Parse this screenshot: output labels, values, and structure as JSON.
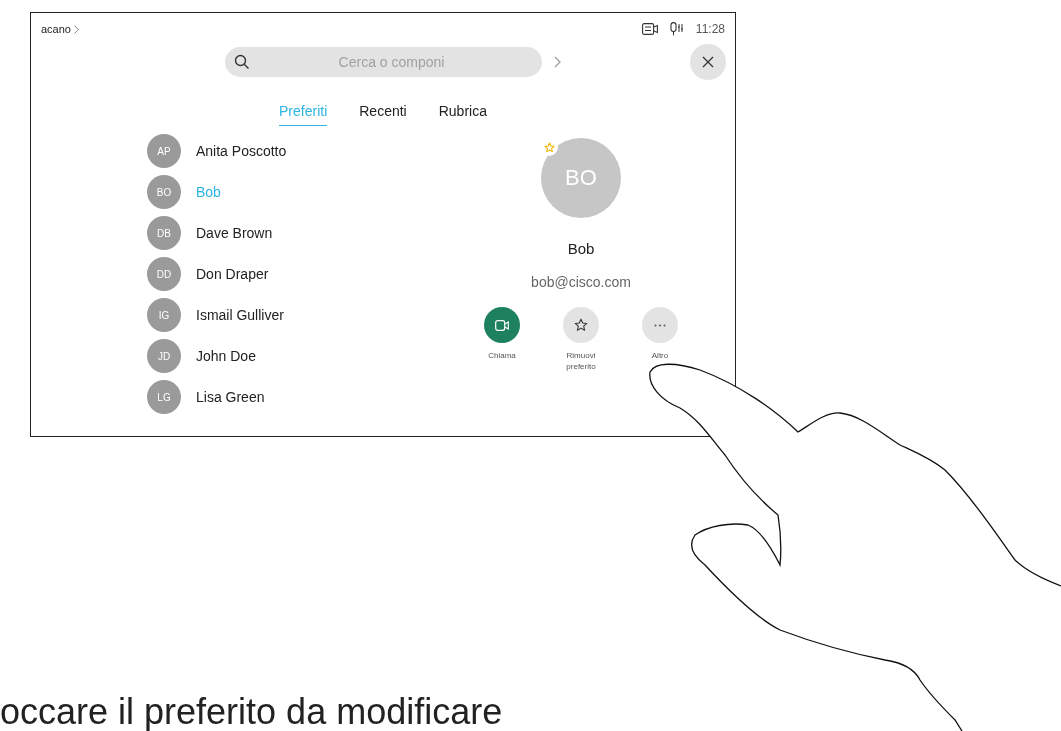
{
  "status_bar": {
    "system_name": "acano",
    "time": "11:28"
  },
  "search": {
    "placeholder": "Cerca o componi"
  },
  "tabs": [
    {
      "label": "Preferiti",
      "selected": true
    },
    {
      "label": "Recenti",
      "selected": false
    },
    {
      "label": "Rubrica",
      "selected": false
    }
  ],
  "contacts": [
    {
      "initials": "AP",
      "name": "Anita Poscotto",
      "selected": false
    },
    {
      "initials": "BO",
      "name": "Bob",
      "selected": true
    },
    {
      "initials": "DB",
      "name": "Dave Brown",
      "selected": false
    },
    {
      "initials": "DD",
      "name": "Don Draper",
      "selected": false
    },
    {
      "initials": "IG",
      "name": "Ismail Gulliver",
      "selected": false
    },
    {
      "initials": "JD",
      "name": "John Doe",
      "selected": false
    },
    {
      "initials": "LG",
      "name": "Lisa Green",
      "selected": false
    }
  ],
  "detail": {
    "initials": "BO",
    "favorite": true,
    "name": "Bob",
    "address": "bob@cisco.com"
  },
  "actions": [
    {
      "kind": "call",
      "label": "Chiama"
    },
    {
      "kind": "unfavorite",
      "label": "Rimuovi preferito"
    },
    {
      "kind": "more",
      "label": "Altro"
    }
  ],
  "caption": "occare il preferito da modificare"
}
